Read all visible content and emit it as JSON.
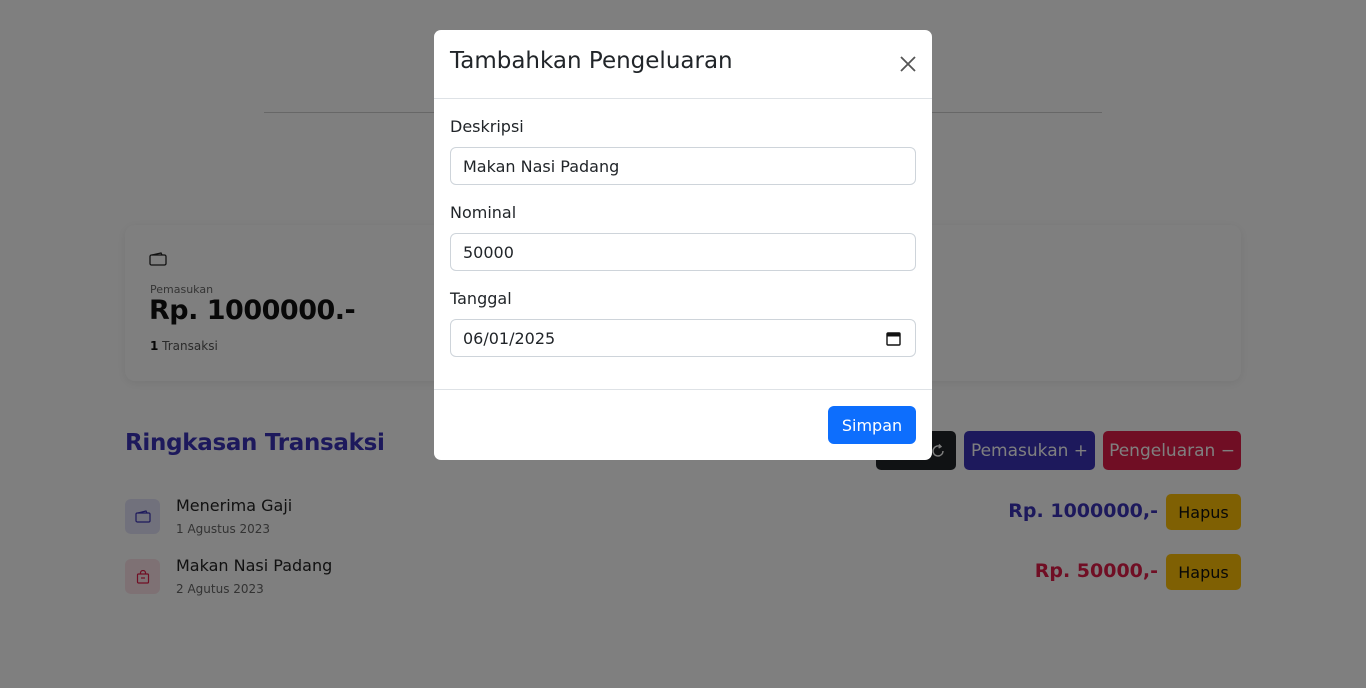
{
  "summary": {
    "income_label": "Pemasukan",
    "income_amount": "Rp. 1000000.-",
    "income_count": "1",
    "income_count_suffix": " Transaksi"
  },
  "section": {
    "title": "Ringkasan Transaksi"
  },
  "buttons": {
    "income": "Pemasukan +",
    "expense": "Pengeluaran −"
  },
  "transactions": [
    {
      "name": "Menerima Gaji",
      "date": "1 Agustus 2023",
      "amount": "Rp. 1000000,-",
      "delete_label": "Hapus",
      "type": "income"
    },
    {
      "name": "Makan Nasi Padang",
      "date": "2 Agutus 2023",
      "amount": "Rp. 50000,-",
      "delete_label": "Hapus",
      "type": "expense"
    }
  ],
  "modal": {
    "title": "Tambahkan Pengeluaran",
    "description_label": "Deskripsi",
    "description_value": "Makan Nasi Padang",
    "nominal_label": "Nominal",
    "nominal_value": "50000",
    "date_label": "Tanggal",
    "date_value": "06/01/2025",
    "save_label": "Simpan"
  },
  "colors": {
    "primary": "#3a33b8",
    "danger": "#e11d48",
    "warning": "#ffc107",
    "save": "#0d6efd"
  }
}
